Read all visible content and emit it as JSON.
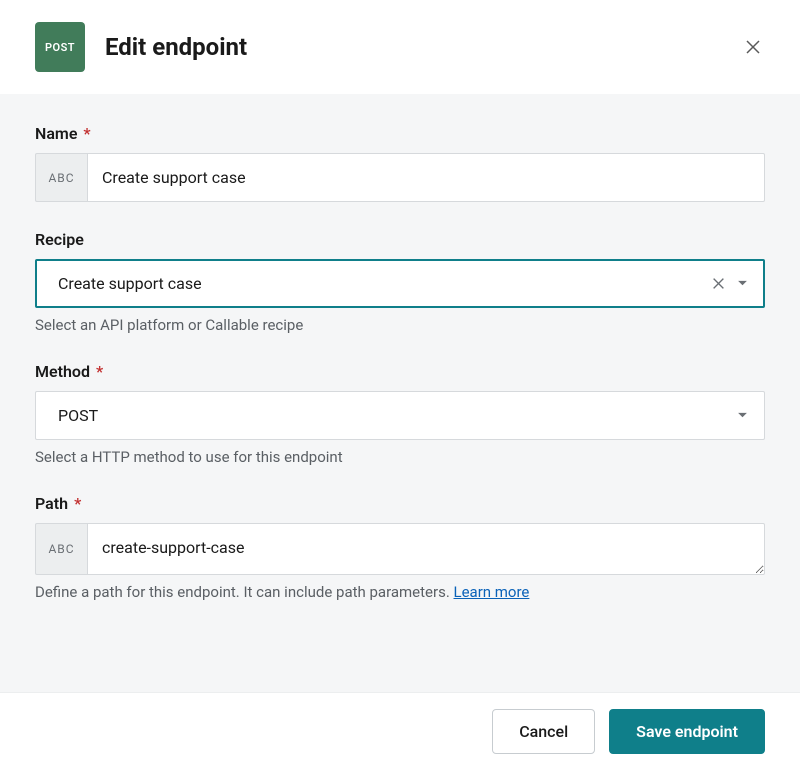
{
  "header": {
    "badge": "POST",
    "title": "Edit endpoint"
  },
  "form": {
    "name": {
      "label": "Name",
      "required": true,
      "prefix": "ABC",
      "value": "Create support case"
    },
    "recipe": {
      "label": "Recipe",
      "value": "Create support case",
      "helper": "Select an API platform or Callable recipe"
    },
    "method": {
      "label": "Method",
      "required": true,
      "value": "POST",
      "helper": "Select a HTTP method to use for this endpoint"
    },
    "path": {
      "label": "Path",
      "required": true,
      "prefix": "ABC",
      "value": "create-support-case",
      "helper_text": "Define a path for this endpoint. It can include path parameters. ",
      "learn_more": "Learn more"
    }
  },
  "footer": {
    "cancel": "Cancel",
    "save": "Save endpoint"
  }
}
